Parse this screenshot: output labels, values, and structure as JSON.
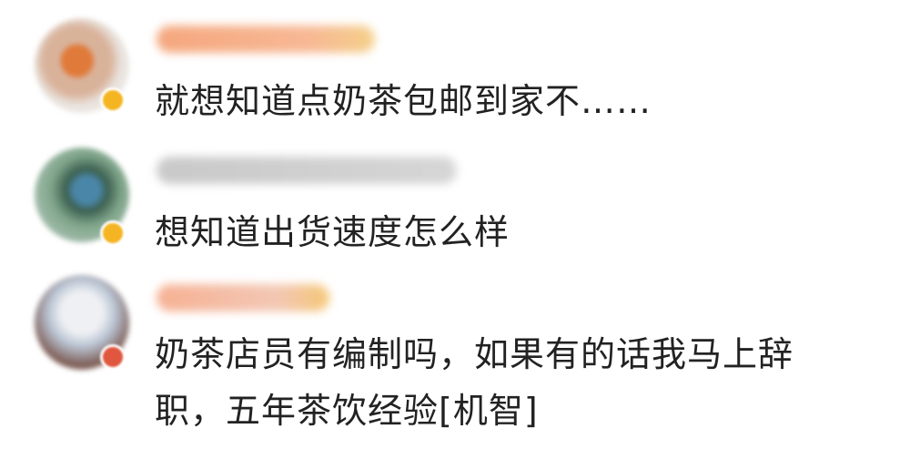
{
  "comments": [
    {
      "text": "就想知道点奶茶包邮到家不……"
    },
    {
      "text": "想知道出货速度怎么样"
    },
    {
      "text_line1": "奶茶店员有编制吗，如果有的话我马上辞",
      "text_line2": "职，五年茶饮经验[机智]"
    }
  ],
  "colors": {
    "text": "#222222",
    "badge_gold": "#f5b422",
    "badge_red": "#e0563f"
  }
}
